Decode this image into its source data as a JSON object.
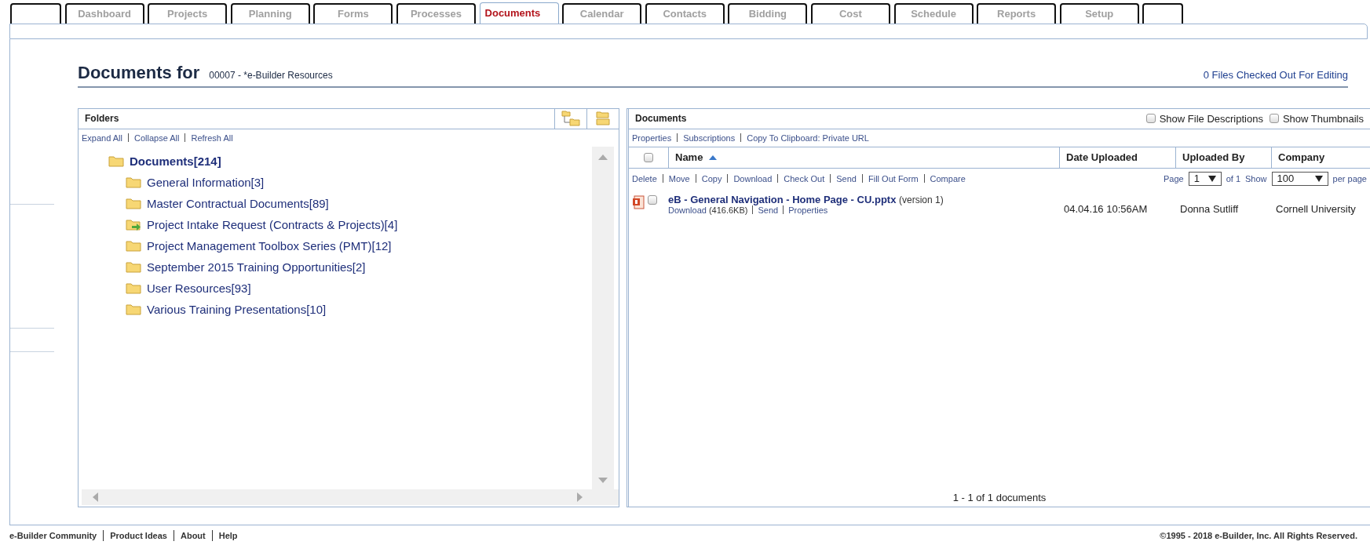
{
  "tabs": [
    {
      "kind": "blank",
      "selected": false
    },
    {
      "kind": "label",
      "label": "Dashboard",
      "selected": false
    },
    {
      "kind": "label",
      "label": "Projects",
      "selected": false
    },
    {
      "kind": "label",
      "label": "Planning",
      "selected": false
    },
    {
      "kind": "label",
      "label": "Forms",
      "selected": false
    },
    {
      "kind": "label",
      "label": "Processes",
      "selected": false
    },
    {
      "kind": "label",
      "label": "Documents",
      "selected": true
    },
    {
      "kind": "label",
      "label": "Calendar",
      "selected": false
    },
    {
      "kind": "label",
      "label": "Contacts",
      "selected": false
    },
    {
      "kind": "label",
      "label": "Bidding",
      "selected": false
    },
    {
      "kind": "label",
      "label": "Cost",
      "selected": false
    },
    {
      "kind": "label",
      "label": "Schedule",
      "selected": false
    },
    {
      "kind": "label",
      "label": "Reports",
      "selected": false
    },
    {
      "kind": "label",
      "label": "Setup",
      "selected": false
    },
    {
      "kind": "blank",
      "selected": false
    }
  ],
  "header": {
    "title": "Documents for",
    "project": "00007 - *e-Builder Resources",
    "checked_out": "0 Files Checked Out For Editing"
  },
  "folders_panel": {
    "title": "Folders",
    "links": [
      "Expand All",
      "Collapse All",
      "Refresh All"
    ],
    "tree": [
      {
        "label": "Documents[214]",
        "kind": "folder",
        "children": [
          {
            "label": "General Information[3]",
            "kind": "folder"
          },
          {
            "label": "Master Contractual Documents[89]",
            "kind": "folder"
          },
          {
            "label": "Project Intake Request (Contracts & Projects)[4]",
            "kind": "shared"
          },
          {
            "label": "Project Management Toolbox Series (PMT)[12]",
            "kind": "folder"
          },
          {
            "label": "September 2015 Training Opportunities[2]",
            "kind": "folder"
          },
          {
            "label": "User Resources[93]",
            "kind": "folder"
          },
          {
            "label": "Various Training Presentations[10]",
            "kind": "folder"
          }
        ]
      }
    ]
  },
  "documents_panel": {
    "title": "Documents",
    "options": [
      {
        "label": "Show File Descriptions",
        "checked": false
      },
      {
        "label": "Show Thumbnails",
        "checked": false
      }
    ],
    "links": [
      "Properties",
      "Subscriptions",
      "Copy To Clipboard: Private URL"
    ],
    "select_all_checked": false,
    "columns": [
      {
        "label": "Name",
        "sorted": true
      },
      {
        "label": "Date Uploaded",
        "sorted": false
      },
      {
        "label": "Uploaded By",
        "sorted": false
      },
      {
        "label": "Company",
        "sorted": false
      }
    ],
    "actions": [
      "Delete",
      "Move",
      "Copy",
      "Download",
      "Check Out",
      "Send",
      "Fill Out Form",
      "Compare"
    ],
    "pagination": {
      "page_label": "Page",
      "page": "1",
      "of": "of 1",
      "show_label": "Show",
      "per_page": "100",
      "per_page_label": "per page"
    },
    "rows": [
      {
        "kind": "pptx",
        "checked": false,
        "name": "eB - General Navigation - Home Page - CU.pptx",
        "version": "(version 1)",
        "download": "Download",
        "size": "(416.6KB)",
        "links": [
          "Send",
          "Properties"
        ],
        "date": "04.04.16 10:56AM",
        "uploaded_by": "Donna Sutliff",
        "company": "Cornell University"
      }
    ],
    "summary": "1 - 1 of 1 documents"
  },
  "footer": {
    "links": [
      "e-Builder Community",
      "Product Ideas",
      "About",
      "Help"
    ],
    "copyright": "©1995 - 2018 e-Builder, Inc. All Rights Reserved."
  }
}
